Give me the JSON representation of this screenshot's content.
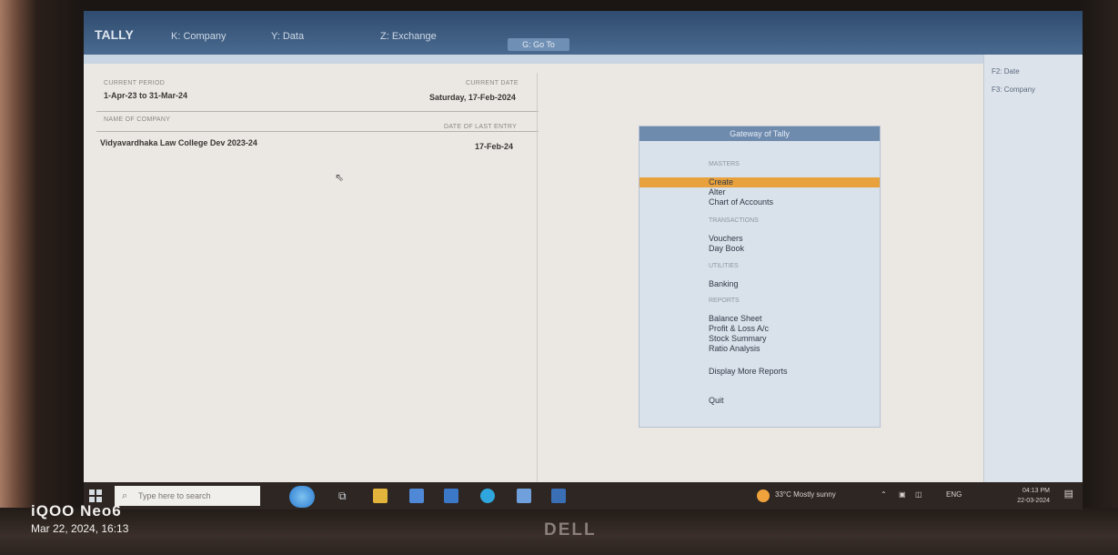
{
  "watermark": {
    "brand": "iQOO Neo6",
    "datetime": "Mar 22, 2024, 16:13"
  },
  "monitor": {
    "brand": "DELL"
  },
  "app": {
    "logo": "TALLY",
    "menu": [
      "K: Company",
      "Y: Data",
      "Z: Exchange",
      "G: Go To"
    ]
  },
  "company": {
    "current_period_label": "CURRENT PERIOD",
    "current_period": "1-Apr-23 to 31-Mar-24",
    "current_date_label": "CURRENT DATE",
    "current_date": "Saturday, 17-Feb-2024",
    "name_label": "NAME OF COMPANY",
    "last_entry_label": "DATE OF LAST ENTRY",
    "name": "Vidyavardhaka Law College Dev 2023-24",
    "last_entry": "17-Feb-24"
  },
  "gateway": {
    "title": "Gateway of Tally",
    "sections": [
      {
        "label": "MASTERS",
        "items": [
          "Create",
          "Alter",
          "Chart of Accounts"
        ]
      },
      {
        "label": "TRANSACTIONS",
        "items": [
          "Vouchers",
          "Day Book"
        ]
      },
      {
        "label": "UTILITIES",
        "items": [
          "Banking"
        ]
      },
      {
        "label": "REPORTS",
        "items": [
          "Balance Sheet",
          "Profit & Loss A/c",
          "Stock Summary",
          "Ratio Analysis"
        ]
      },
      {
        "label": "",
        "items": [
          "Display More Reports"
        ]
      },
      {
        "label": "",
        "items": [
          "Quit"
        ]
      }
    ],
    "selected": "Create"
  },
  "rightbar": [
    "F2: Date",
    "F3: Company"
  ],
  "taskbar": {
    "search_placeholder": "Type here to search",
    "weather": "33°C  Mostly sunny",
    "lang": "ENG",
    "time": "04:13 PM",
    "date": "22-03-2024"
  },
  "colors": {
    "highlight": "#e8a13c",
    "titlebar": "#2f4c6f"
  }
}
